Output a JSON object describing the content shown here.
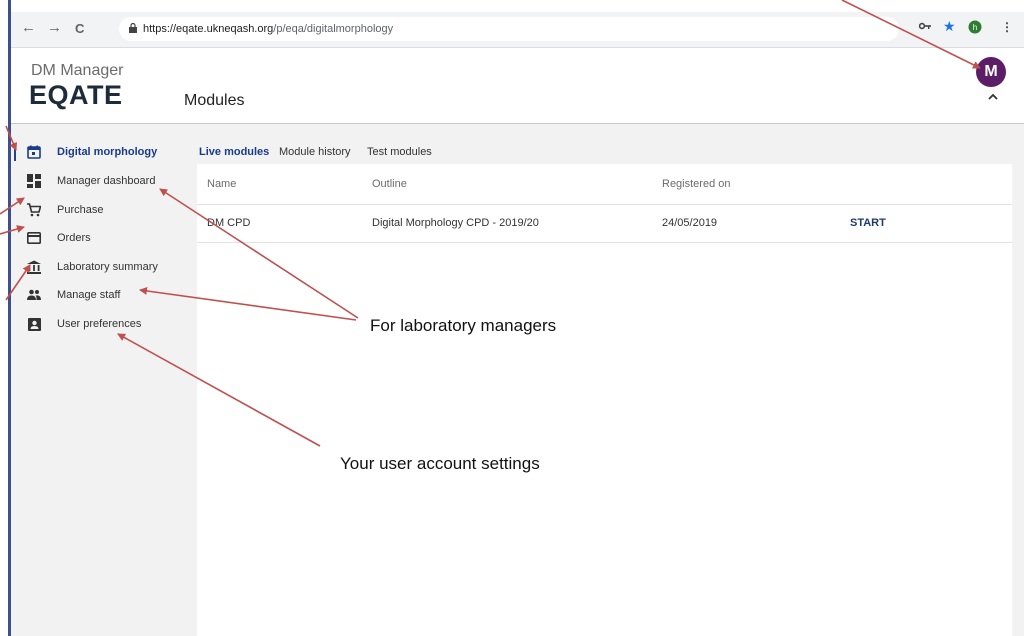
{
  "browser": {
    "url_host": "https://eqate.ukneqash.org",
    "url_path": "/p/eqa/digitalmorphology",
    "nav": {
      "back": "←",
      "forward": "→",
      "reload": "C"
    }
  },
  "header": {
    "brand_small": "DM Manager",
    "brand_large": "EQATE",
    "page_title": "Modules",
    "avatar_letter": "M",
    "avatar_color": "#5b1d66"
  },
  "sidebar": {
    "items": [
      {
        "label": "Digital morphology",
        "icon": "calendar-icon",
        "active": true
      },
      {
        "label": "Manager dashboard",
        "icon": "dashboard-icon",
        "active": false
      },
      {
        "label": "Purchase",
        "icon": "cart-icon",
        "active": false
      },
      {
        "label": "Orders",
        "icon": "card-icon",
        "active": false
      },
      {
        "label": "Laboratory summary",
        "icon": "bank-icon",
        "active": false
      },
      {
        "label": "Manage staff",
        "icon": "people-icon",
        "active": false
      },
      {
        "label": "User preferences",
        "icon": "account-box-icon",
        "active": false
      }
    ]
  },
  "main": {
    "tabs": [
      {
        "label": "Live modules",
        "active": true
      },
      {
        "label": "Module history",
        "active": false
      },
      {
        "label": "Test modules",
        "active": false
      }
    ],
    "table": {
      "columns": [
        "Name",
        "Outline",
        "Registered on"
      ],
      "rows": [
        {
          "name": "DM CPD",
          "outline": "Digital Morphology CPD - 2019/20",
          "registered": "24/05/2019",
          "action": "START"
        }
      ]
    }
  },
  "annotations": {
    "managers_note": "For laboratory managers",
    "settings_note": "Your user account settings",
    "arrow_color": "#c0504d"
  },
  "colors": {
    "accent": "#1a3a8a",
    "sidebar_bg": "#f2f2f2"
  }
}
